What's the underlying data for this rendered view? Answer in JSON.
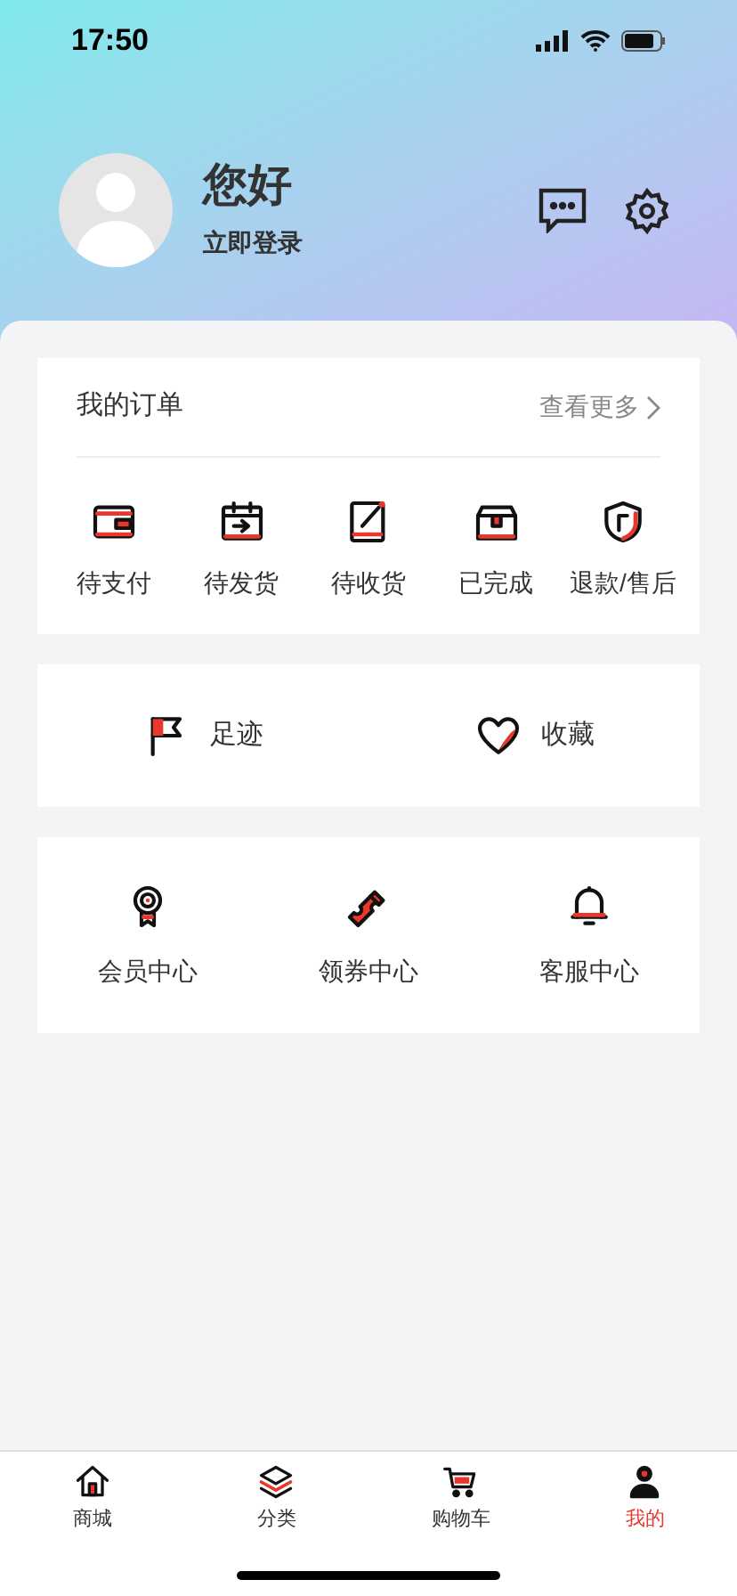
{
  "status_bar": {
    "time": "17:50"
  },
  "profile": {
    "greeting": "您好",
    "login": "立即登录"
  },
  "orders": {
    "title": "我的订单",
    "more": "查看更多",
    "items": [
      {
        "label": "待支付"
      },
      {
        "label": "待发货"
      },
      {
        "label": "待收货"
      },
      {
        "label": "已完成"
      },
      {
        "label": "退款/售后"
      }
    ]
  },
  "shortcuts": [
    {
      "label": "足迹"
    },
    {
      "label": "收藏"
    }
  ],
  "services": [
    {
      "label": "会员中心"
    },
    {
      "label": "领券中心"
    },
    {
      "label": "客服中心"
    }
  ],
  "tab_bar": [
    {
      "label": "商城",
      "selected": false
    },
    {
      "label": "分类",
      "selected": false
    },
    {
      "label": "购物车",
      "selected": false
    },
    {
      "label": "我的",
      "selected": true
    }
  ]
}
